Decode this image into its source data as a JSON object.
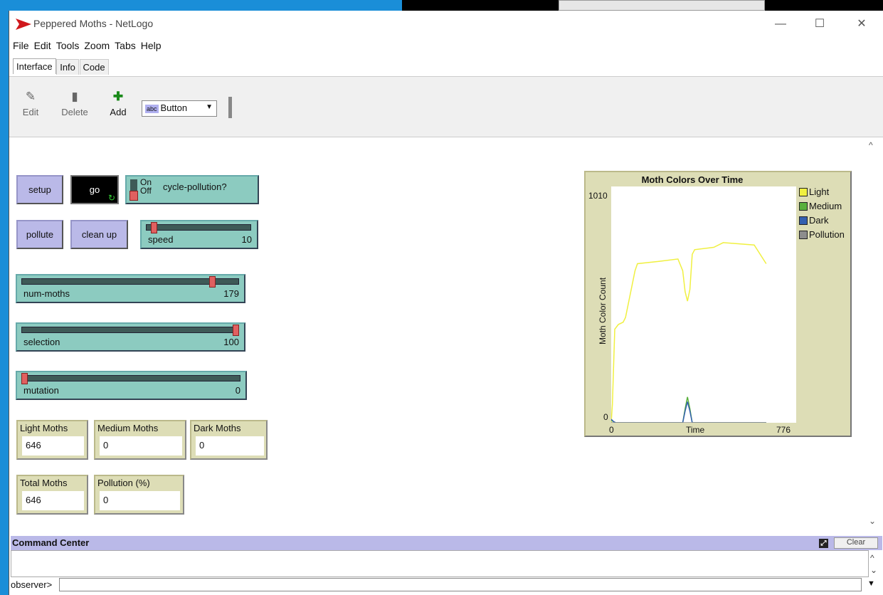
{
  "window": {
    "title": "Peppered Moths - NetLogo"
  },
  "menu": [
    "File",
    "Edit",
    "Tools",
    "Zoom",
    "Tabs",
    "Help"
  ],
  "tabs": [
    "Interface",
    "Info",
    "Code"
  ],
  "toolbar": {
    "edit": "Edit",
    "delete": "Delete",
    "add": "Add",
    "widget_type": "Button"
  },
  "buttons": {
    "setup": "setup",
    "go": "go",
    "pollute": "pollute",
    "clean_up": "clean up"
  },
  "switch": {
    "label": "cycle-pollution?",
    "on": "On",
    "off": "Off",
    "state": "off"
  },
  "sliders": {
    "speed": {
      "label": "speed",
      "value": "10",
      "fraction": 0.05
    },
    "num_moths": {
      "label": "num-moths",
      "value": "179",
      "fraction": 0.89
    },
    "selection": {
      "label": "selection",
      "value": "100",
      "fraction": 1.0
    },
    "mutation": {
      "label": "mutation",
      "value": "0",
      "fraction": 0.0
    }
  },
  "monitors": {
    "light": {
      "label": "Light Moths",
      "value": "646"
    },
    "medium": {
      "label": "Medium Moths",
      "value": "0"
    },
    "dark": {
      "label": "Dark Moths",
      "value": "0"
    },
    "total": {
      "label": "Total Moths",
      "value": "646"
    },
    "pollution": {
      "label": "Pollution (%)",
      "value": "0"
    }
  },
  "plot": {
    "title": "Moth Colors Over Time",
    "ylabel": "Moth Color Count",
    "xlabel": "Time",
    "ymax": "1010",
    "ymin": "0",
    "xmin": "0",
    "xmax": "776",
    "legend": [
      {
        "name": "Light",
        "color": "#f0f040"
      },
      {
        "name": "Medium",
        "color": "#59b03c"
      },
      {
        "name": "Dark",
        "color": "#3460b0"
      },
      {
        "name": "Pollution",
        "color": "#8d8d8d"
      }
    ]
  },
  "chart_data": {
    "type": "line",
    "title": "Moth Colors Over Time",
    "xlabel": "Time",
    "ylabel": "Moth Color Count",
    "xlim": [
      0,
      776
    ],
    "ylim": [
      0,
      1010
    ],
    "legend_position": "right",
    "series": [
      {
        "name": "Light",
        "color": "#f0f040",
        "x": [
          0,
          5,
          15,
          30,
          50,
          60,
          100,
          110,
          200,
          280,
          300,
          310,
          320,
          330,
          340,
          350,
          430,
          470,
          600,
          650
        ],
        "values": [
          0,
          80,
          400,
          420,
          430,
          450,
          650,
          680,
          690,
          700,
          650,
          560,
          520,
          570,
          720,
          740,
          750,
          770,
          760,
          680
        ]
      },
      {
        "name": "Medium",
        "color": "#59b03c",
        "x": [
          0,
          10,
          20,
          300,
          310,
          320,
          330,
          340,
          650
        ],
        "values": [
          10,
          5,
          0,
          0,
          60,
          110,
          60,
          0,
          0
        ]
      },
      {
        "name": "Dark",
        "color": "#3460b0",
        "x": [
          0,
          10,
          20,
          300,
          310,
          320,
          330,
          340,
          650
        ],
        "values": [
          15,
          5,
          0,
          0,
          50,
          90,
          50,
          0,
          0
        ]
      },
      {
        "name": "Pollution",
        "color": "#8d8d8d",
        "x": [
          0,
          650
        ],
        "values": [
          0,
          0
        ]
      }
    ]
  },
  "command_center": {
    "title": "Command Center",
    "clear": "Clear",
    "prompt": "observer>"
  }
}
